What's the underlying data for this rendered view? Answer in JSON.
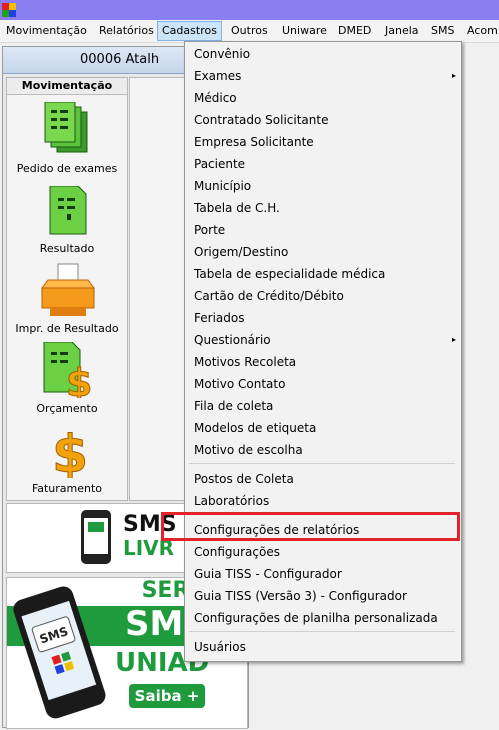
{
  "menubar": {
    "items": [
      "Movimentação",
      "Relatórios",
      "Cadastros",
      "Outros",
      "Uniware",
      "DMED",
      "Janela",
      "SMS",
      "Acom"
    ]
  },
  "header": {
    "title": "00006 Atalh"
  },
  "shortcuts": {
    "title": "Movimentação",
    "items": [
      "Pedido de exames",
      "Resultado",
      "Impr. de Resultado",
      "Orçamento",
      "Faturamento"
    ]
  },
  "ads": {
    "sms_livre_1": "SMS",
    "sms_livre_2": "LIVR",
    "phone_screen": "SMS",
    "serv": "SERV",
    "sms": "SMS",
    "uniad": "UNIAD",
    "saiba": "Saiba +"
  },
  "dropdown": {
    "items": [
      "Convênio",
      "Exames",
      "Médico",
      "Contratado Solicitante",
      "Empresa Solicitante",
      "Paciente",
      "Município",
      "Tabela de C.H.",
      "Porte",
      "Origem/Destino",
      "Tabela de especialidade médica",
      "Cartão de Crédito/Débito",
      "Feriados",
      "Questionário",
      "Motivos Recoleta",
      "Motivo Contato",
      "Fila de coleta",
      "Modelos de etiqueta",
      "Motivo de escolha",
      "Postos de Coleta",
      "Laboratórios",
      "Configurações de relatórios",
      "Configurações",
      "Guia TISS - Configurador",
      "Guia TISS (Versão 3) - Configurador",
      "Configurações de planilha personalizada",
      "Usuários"
    ],
    "submenu_arrow": "▸"
  },
  "colors": {
    "titlebar": "#8a7ff0",
    "menu_active_bg": "#cce4f7",
    "highlight_border": "#e0242a",
    "ad_green": "#1f9a3c"
  },
  "icons": [
    "app-logo-icon",
    "pedido-exames-icon",
    "resultado-icon",
    "printer-icon",
    "orcamento-icon",
    "dollar-icon",
    "phone-sms-icon"
  ]
}
